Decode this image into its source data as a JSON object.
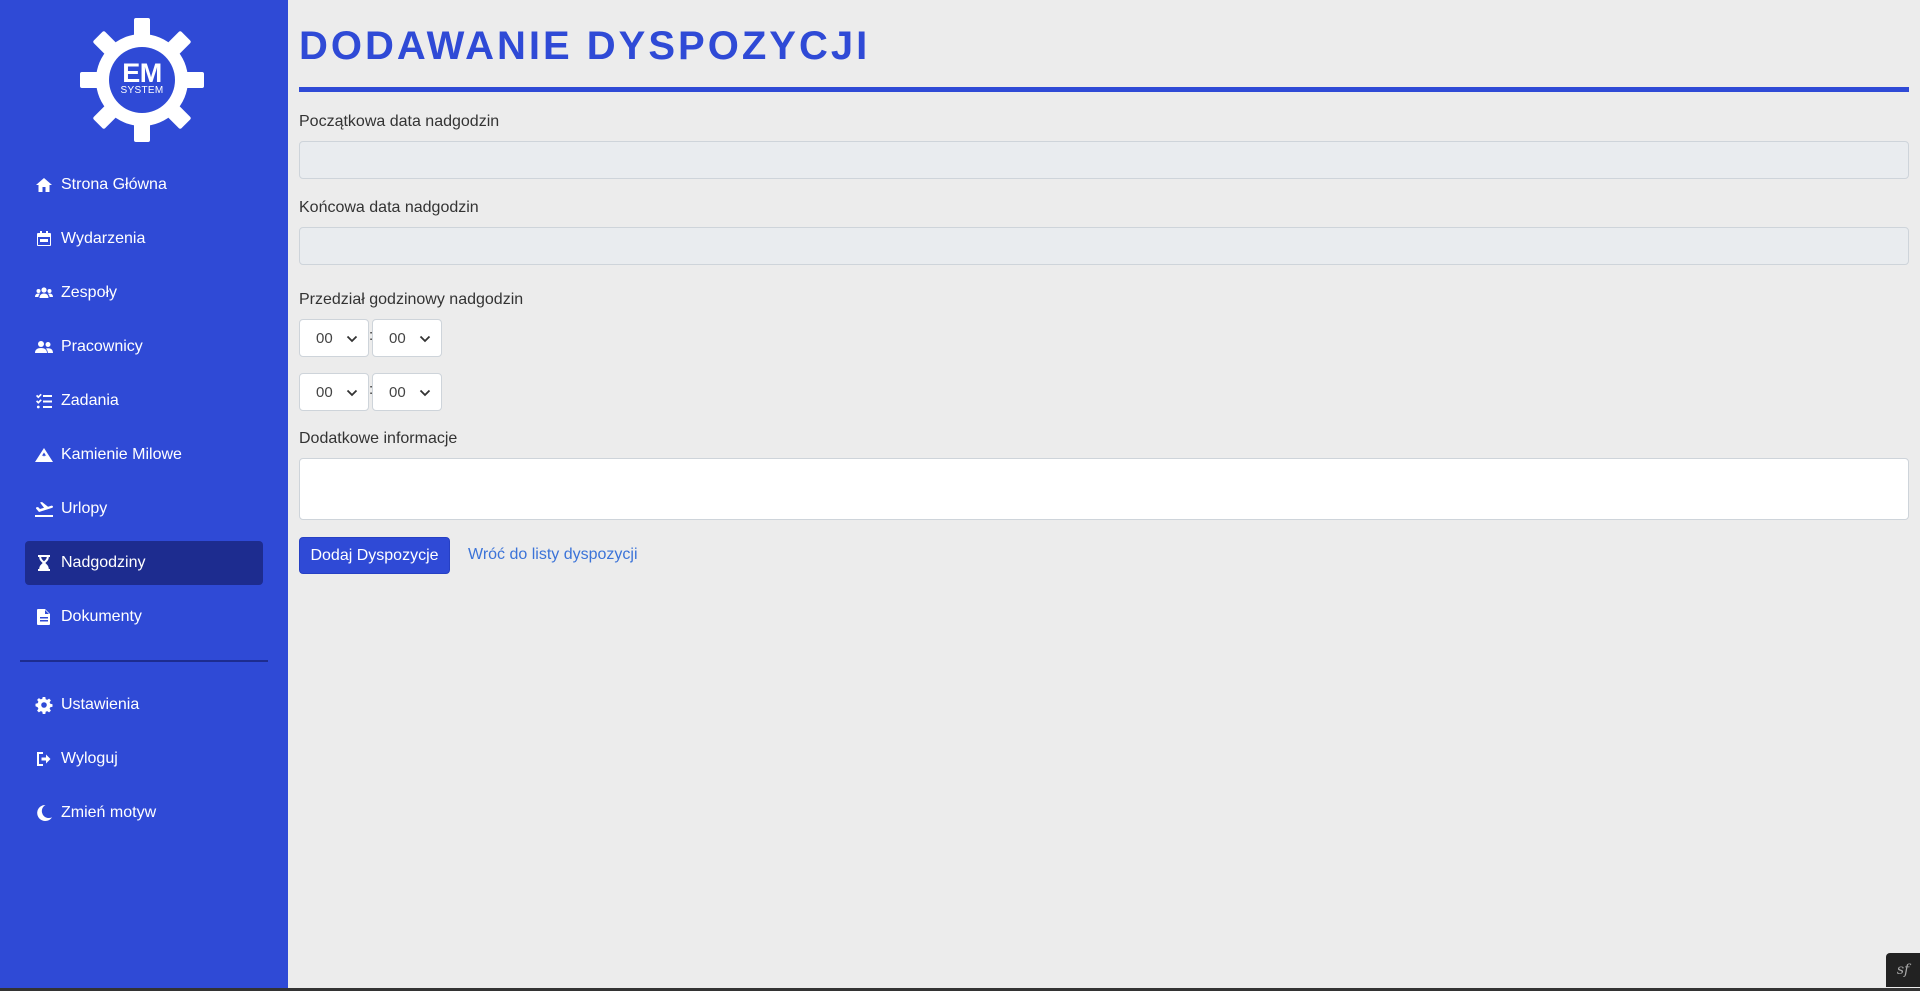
{
  "logo": {
    "primary": "EM",
    "secondary": "SYSTEM"
  },
  "sidebar": {
    "items": [
      {
        "label": "Strona Główna",
        "icon": "home-icon"
      },
      {
        "label": "Wydarzenia",
        "icon": "calendar-icon"
      },
      {
        "label": "Zespoły",
        "icon": "users-icon"
      },
      {
        "label": "Pracownicy",
        "icon": "user-group-icon"
      },
      {
        "label": "Zadania",
        "icon": "task-list-icon"
      },
      {
        "label": "Kamienie Milowe",
        "icon": "mountain-icon"
      },
      {
        "label": "Urlopy",
        "icon": "plane-icon"
      },
      {
        "label": "Nadgodziny",
        "icon": "hourglass-icon",
        "active": true
      },
      {
        "label": "Dokumenty",
        "icon": "document-icon"
      }
    ],
    "bottom_items": [
      {
        "label": "Ustawienia",
        "icon": "gear-icon"
      },
      {
        "label": "Wyloguj",
        "icon": "logout-icon"
      },
      {
        "label": "Zmień motyw",
        "icon": "moon-icon"
      }
    ]
  },
  "page": {
    "title": "DODAWANIE DYSPOZYCJI",
    "start_date_label": "Początkowa data nadgodzin",
    "start_date_value": "",
    "end_date_label": "Końcowa data nadgodzin",
    "end_date_value": "",
    "time_range_label": "Przedział godzinowy nadgodzin",
    "time_from": {
      "hour": "00",
      "minute": "00"
    },
    "time_to": {
      "hour": "00",
      "minute": "00"
    },
    "time_separator": ":",
    "info_label": "Dodatkowe informacje",
    "info_value": "",
    "submit_label": "Dodaj Dyspozycje",
    "back_link_label": "Wróć do listy dyspozycji"
  },
  "colors": {
    "brand": "#2f4ad6",
    "sidebar_active": "#1d2c8f",
    "background": "#ececec",
    "link": "#3b73d8"
  },
  "debug_badge": "sf"
}
